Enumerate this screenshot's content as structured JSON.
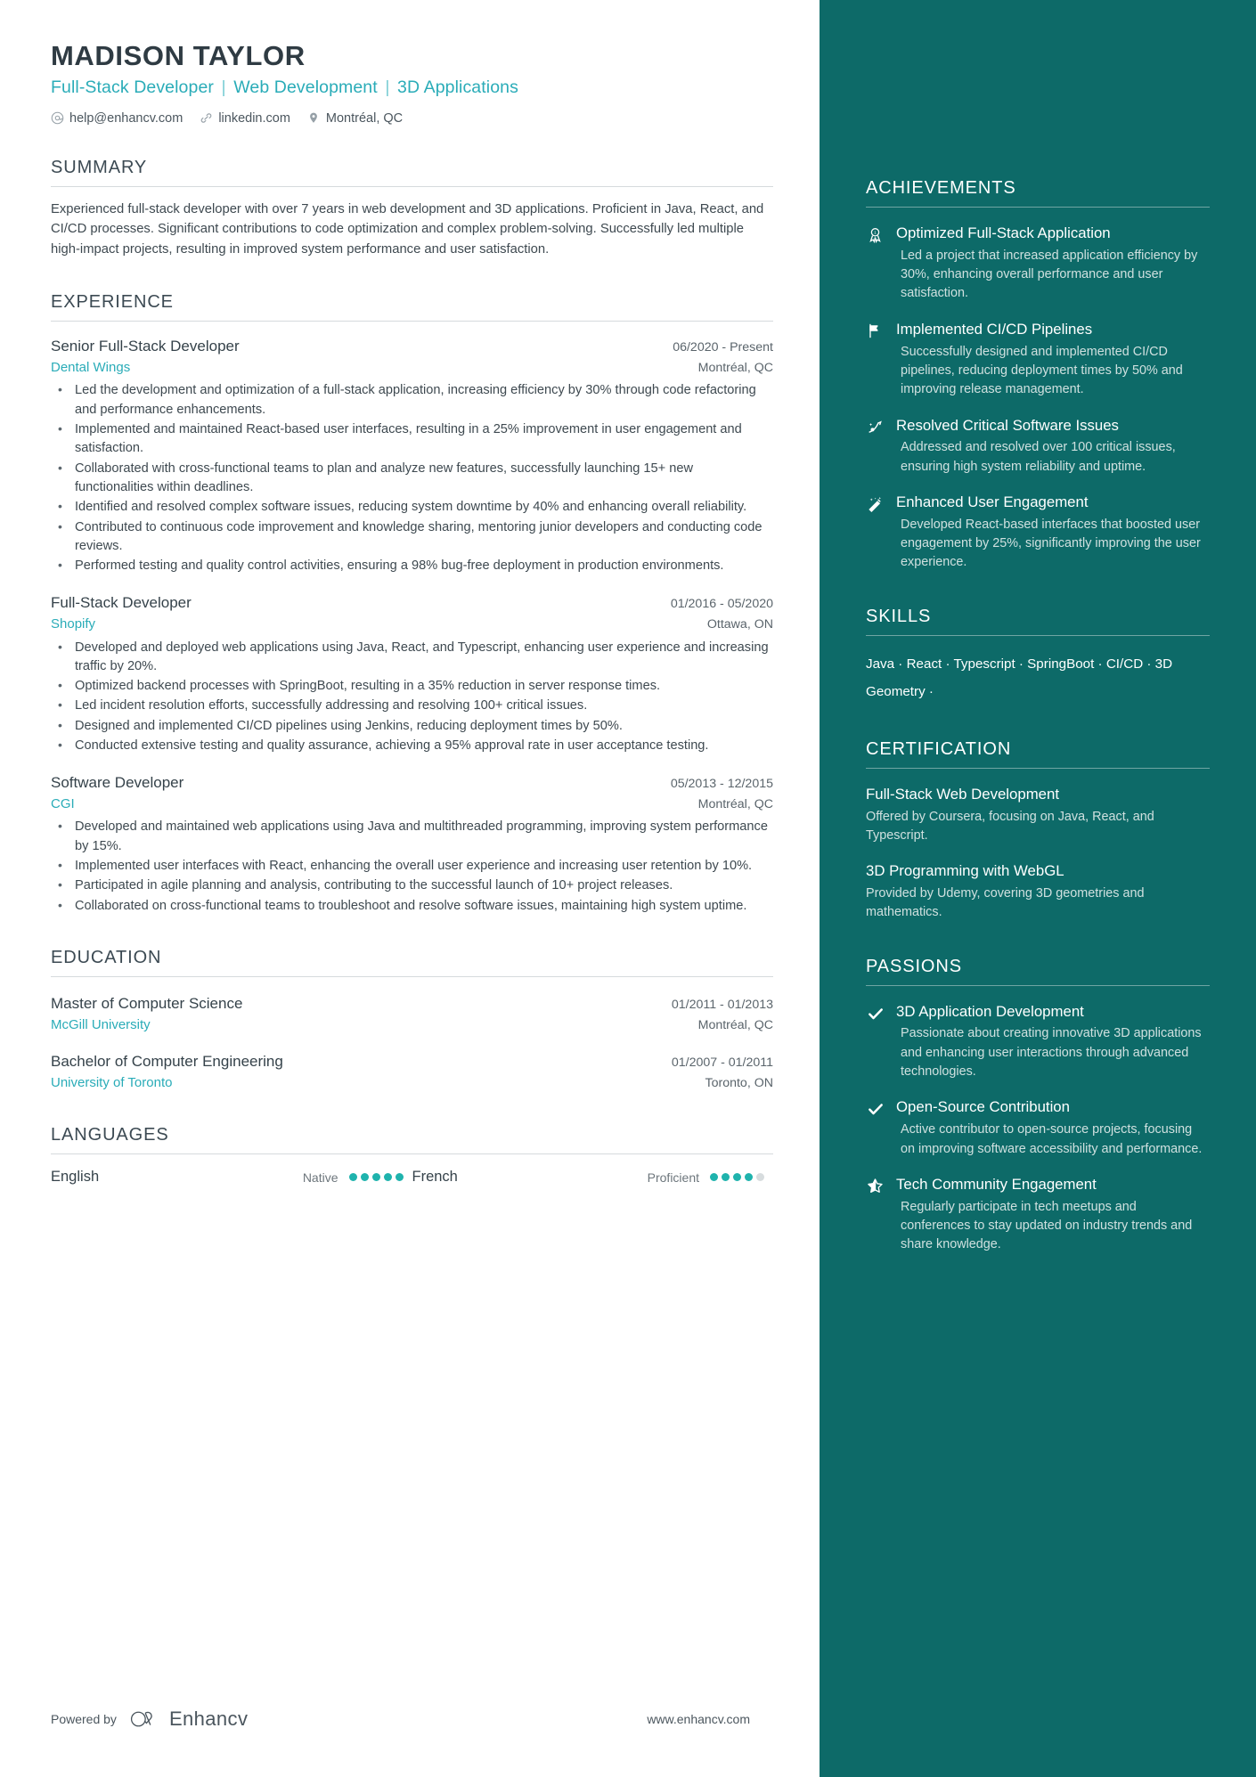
{
  "header": {
    "name": "MADISON TAYLOR",
    "headline_parts": [
      "Full-Stack Developer",
      "Web Development",
      "3D Applications"
    ],
    "separator": "|",
    "contacts": [
      {
        "icon": "email-icon",
        "text": "help@enhancv.com"
      },
      {
        "icon": "link-icon",
        "text": "linkedin.com"
      },
      {
        "icon": "location-pin-icon",
        "text": "Montréal, QC"
      }
    ]
  },
  "summary": {
    "title": "SUMMARY",
    "text": "Experienced full-stack developer with over 7 years in web development and 3D applications. Proficient in Java, React, and CI/CD processes. Significant contributions to code optimization and complex problem-solving. Successfully led multiple high-impact projects, resulting in improved system performance and user satisfaction."
  },
  "experience": {
    "title": "EXPERIENCE",
    "entries": [
      {
        "role": "Senior Full-Stack Developer",
        "date": "06/2020 - Present",
        "company": "Dental Wings",
        "location": "Montréal, QC",
        "bullets": [
          "Led the development and optimization of a full-stack application, increasing efficiency by 30% through code refactoring and performance enhancements.",
          "Implemented and maintained React-based user interfaces, resulting in a 25% improvement in user engagement and satisfaction.",
          "Collaborated with cross-functional teams to plan and analyze new features, successfully launching 15+ new functionalities within deadlines.",
          "Identified and resolved complex software issues, reducing system downtime by 40% and enhancing overall reliability.",
          "Contributed to continuous code improvement and knowledge sharing, mentoring junior developers and conducting code reviews.",
          "Performed testing and quality control activities, ensuring a 98% bug-free deployment in production environments."
        ]
      },
      {
        "role": "Full-Stack Developer",
        "date": "01/2016 - 05/2020",
        "company": "Shopify",
        "location": "Ottawa, ON",
        "bullets": [
          "Developed and deployed web applications using Java, React, and Typescript, enhancing user experience and increasing traffic by 20%.",
          "Optimized backend processes with SpringBoot, resulting in a 35% reduction in server response times.",
          "Led incident resolution efforts, successfully addressing and resolving 100+ critical issues.",
          "Designed and implemented CI/CD pipelines using Jenkins, reducing deployment times by 50%.",
          "Conducted extensive testing and quality assurance, achieving a 95% approval rate in user acceptance testing."
        ]
      },
      {
        "role": "Software Developer",
        "date": "05/2013 - 12/2015",
        "company": "CGI",
        "location": "Montréal, QC",
        "bullets": [
          "Developed and maintained web applications using Java and multithreaded programming, improving system performance by 15%.",
          "Implemented user interfaces with React, enhancing the overall user experience and increasing user retention by 10%.",
          "Participated in agile planning and analysis, contributing to the successful launch of 10+ project releases.",
          "Collaborated on cross-functional teams to troubleshoot and resolve software issues, maintaining high system uptime."
        ]
      }
    ]
  },
  "education": {
    "title": "EDUCATION",
    "entries": [
      {
        "degree": "Master of Computer Science",
        "date": "01/2011 - 01/2013",
        "school": "McGill University",
        "location": "Montréal, QC"
      },
      {
        "degree": "Bachelor of Computer Engineering",
        "date": "01/2007 - 01/2011",
        "school": "University of Toronto",
        "location": "Toronto, ON"
      }
    ]
  },
  "languages": {
    "title": "LANGUAGES",
    "items": [
      {
        "name": "English",
        "level": "Native",
        "rating": 5,
        "max": 5
      },
      {
        "name": "French",
        "level": "Proficient",
        "rating": 4,
        "max": 5
      }
    ]
  },
  "achievements": {
    "title": "ACHIEVEMENTS",
    "items": [
      {
        "icon": "award-ribbon-icon",
        "title": "Optimized Full-Stack Application",
        "desc": "Led a project that increased application efficiency by 30%, enhancing overall performance and user satisfaction."
      },
      {
        "icon": "flag-icon",
        "title": "Implemented CI/CD Pipelines",
        "desc": "Successfully designed and implemented CI/CD pipelines, reducing deployment times by 50% and improving release management."
      },
      {
        "icon": "rocket-trail-icon",
        "title": "Resolved Critical Software Issues",
        "desc": "Addressed and resolved over 100 critical issues, ensuring high system reliability and uptime."
      },
      {
        "icon": "magic-wand-icon",
        "title": "Enhanced User Engagement",
        "desc": "Developed React-based interfaces that boosted user engagement by 25%, significantly improving the user experience."
      }
    ]
  },
  "skills": {
    "title": "SKILLS",
    "items": [
      "Java",
      "React",
      "Typescript",
      "SpringBoot",
      "CI/CD",
      "3D Geometry"
    ],
    "separator": "·"
  },
  "certification": {
    "title": "CERTIFICATION",
    "items": [
      {
        "title": "Full-Stack Web Development",
        "desc": "Offered by Coursera, focusing on Java, React, and Typescript."
      },
      {
        "title": "3D Programming with WebGL",
        "desc": "Provided by Udemy, covering 3D geometries and mathematics."
      }
    ]
  },
  "passions": {
    "title": "PASSIONS",
    "items": [
      {
        "icon": "check-icon",
        "title": "3D Application Development",
        "desc": "Passionate about creating innovative 3D applications and enhancing user interactions through advanced technologies."
      },
      {
        "icon": "check-icon",
        "title": "Open-Source Contribution",
        "desc": "Active contributor to open-source projects, focusing on improving software accessibility and performance."
      },
      {
        "icon": "star-icon",
        "title": "Tech Community Engagement",
        "desc": "Regularly participate in tech meetups and conferences to stay updated on industry trends and share knowledge."
      }
    ]
  },
  "footer": {
    "powered_by": "Powered by",
    "brand": "Enhancv",
    "url": "www.enhancv.com"
  },
  "colors": {
    "accent_teal": "#2aacb8",
    "sidebar_bg": "#0d6a68",
    "dot_on": "#1fb3ad",
    "text_dark": "#3e4950"
  }
}
